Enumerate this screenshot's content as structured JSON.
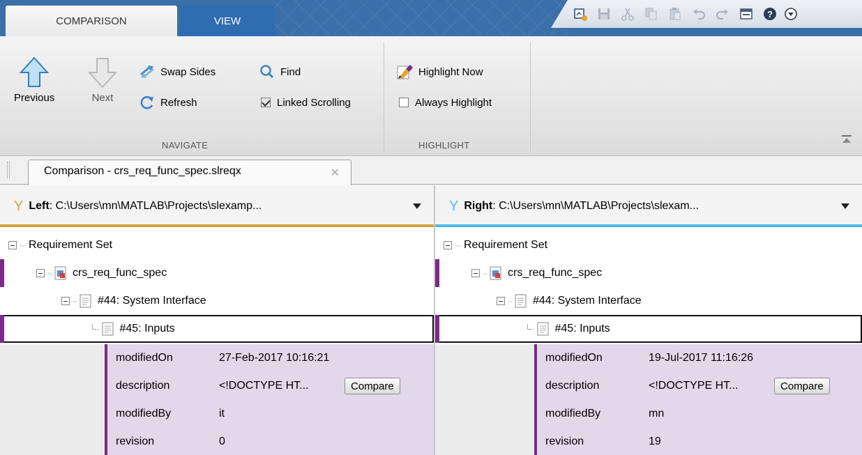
{
  "ribbon_tabs": {
    "comparison": "COMPARISON",
    "view": "VIEW"
  },
  "navigate": {
    "previous": "Previous",
    "next": "Next",
    "swap_sides": "Swap Sides",
    "refresh": "Refresh",
    "find": "Find",
    "linked_scrolling": "Linked Scrolling",
    "linked_scrolling_checked": true,
    "group_label": "NAVIGATE"
  },
  "highlight": {
    "highlight_now": "Highlight Now",
    "always_highlight": "Always Highlight",
    "always_highlight_checked": false,
    "group_label": "HIGHLIGHT"
  },
  "document_tab": {
    "title": "Comparison - crs_req_func_spec.slreqx",
    "close": "✕"
  },
  "left": {
    "side": "Left",
    "path": ": C:\\Users\\mn\\MATLAB\\Projects\\slexamp...",
    "accent": "#d8a23a",
    "tree": {
      "root": "Requirement Set",
      "spec": "crs_req_func_spec",
      "item44": "#44: System Interface",
      "item45": "#45: Inputs"
    },
    "props": {
      "modifiedOn_key": "modifiedOn",
      "modifiedOn": "27-Feb-2017 10:16:21",
      "description_key": "description",
      "description": "<!DOCTYPE HT...",
      "compare": "Compare",
      "modifiedBy_key": "modifiedBy",
      "modifiedBy": "it",
      "revision_key": "revision",
      "revision": "0"
    }
  },
  "right": {
    "side": "Right",
    "path": ": C:\\Users\\mn\\MATLAB\\Projects\\slexam...",
    "accent": "#4fb9e8",
    "tree": {
      "root": "Requirement Set",
      "spec": "crs_req_func_spec",
      "item44": "#44: System Interface",
      "item45": "#45: Inputs"
    },
    "props": {
      "modifiedOn_key": "modifiedOn",
      "modifiedOn": "19-Jul-2017 11:16:26",
      "description_key": "description",
      "description": "<!DOCTYPE HT...",
      "compare": "Compare",
      "modifiedBy_key": "modifiedBy",
      "modifiedBy": "mn",
      "revision_key": "revision",
      "revision": "19"
    }
  },
  "colors": {
    "tab_blue": "#3a6fa8",
    "purple_marker": "#7a2a8a",
    "prop_bg": "#e3d7ea"
  }
}
